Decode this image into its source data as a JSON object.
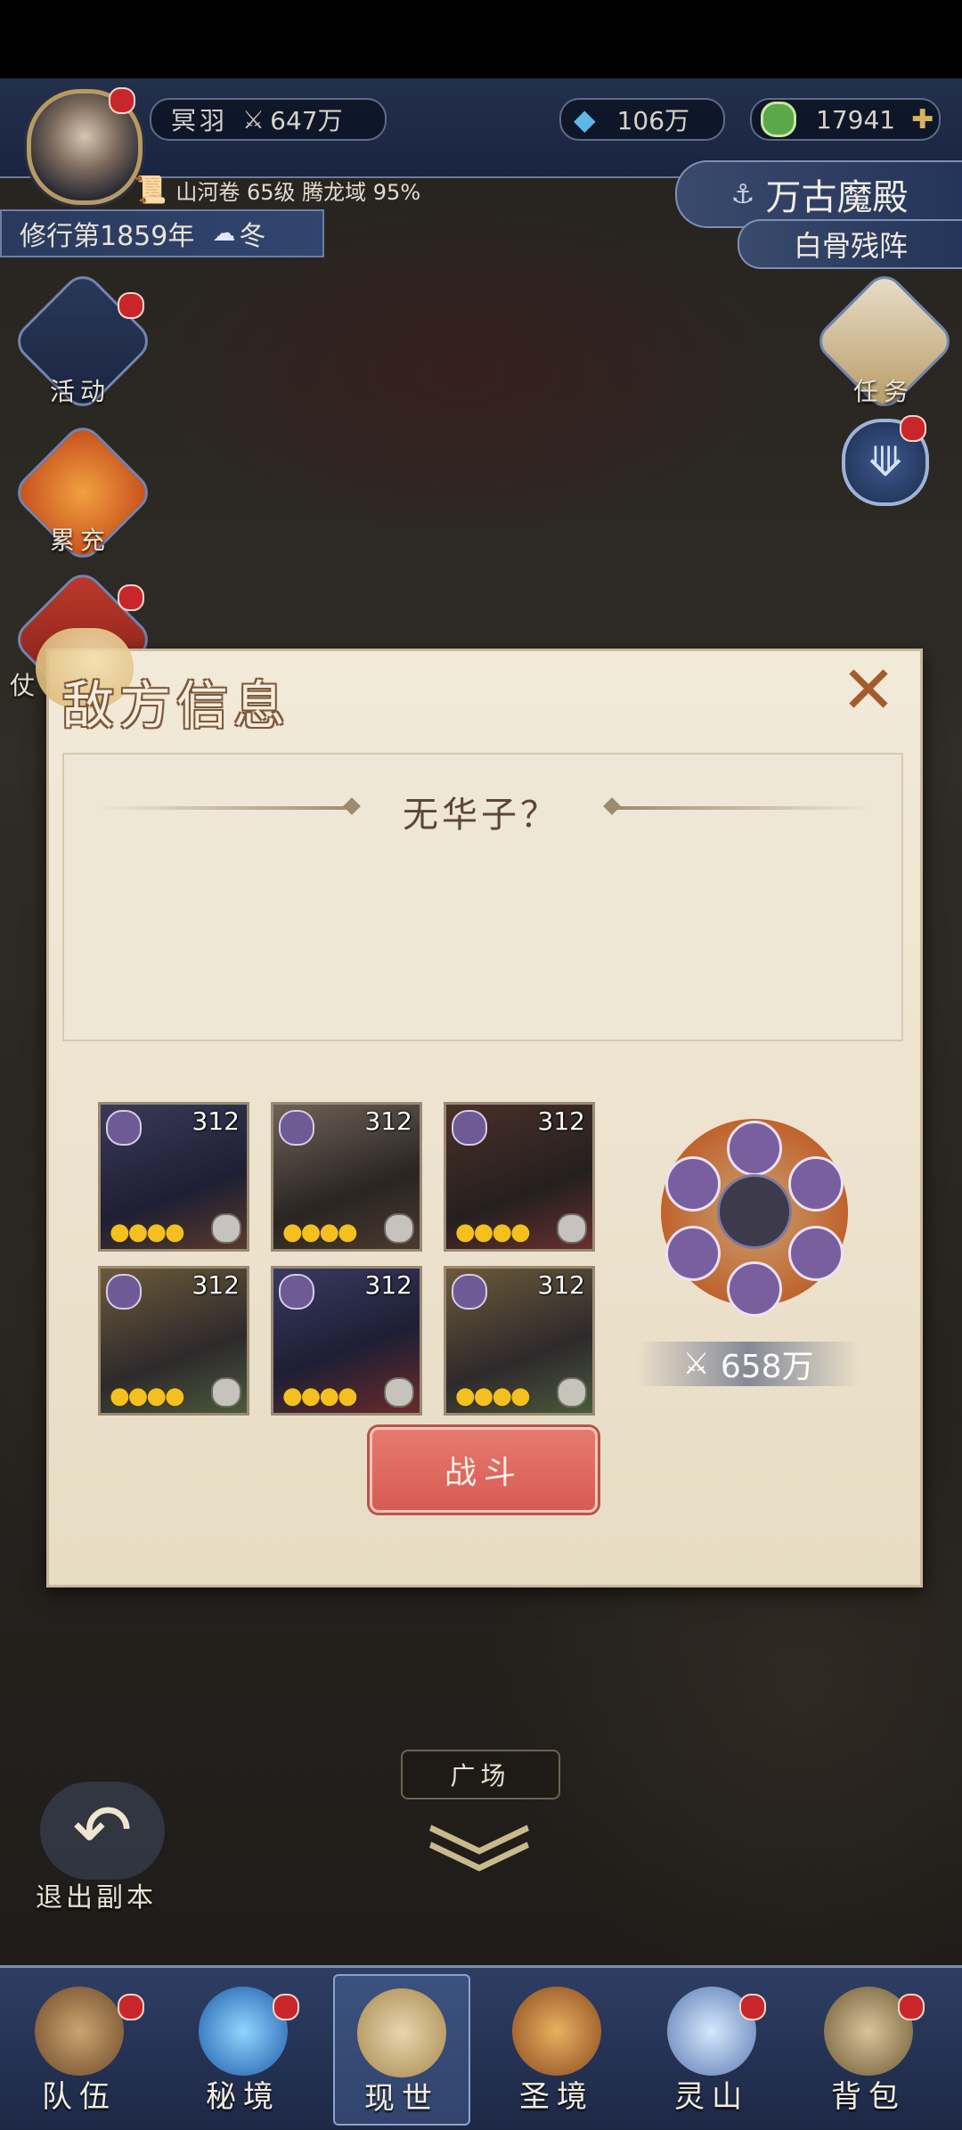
{
  "topbar": {
    "player_name": "冥羽",
    "player_power": "647万",
    "crystal": "106万",
    "jade": "17941",
    "level_info": "山河卷 65级 腾龙域 95%",
    "year": "修行第1859年",
    "season": "冬"
  },
  "location": {
    "title": "万古魔殿",
    "subtitle": "白骨残阵"
  },
  "side_left": [
    {
      "label": "活动"
    },
    {
      "label": "累充"
    },
    {
      "label": "仗"
    }
  ],
  "side_right": [
    {
      "label": "任务"
    }
  ],
  "dialog": {
    "title": "敌方信息",
    "enemy_name": "无华子？",
    "formation_power": "658万",
    "fight_label": "战斗",
    "cards": [
      {
        "level": "312",
        "stars": "●●●●"
      },
      {
        "level": "312",
        "stars": "●●●●"
      },
      {
        "level": "312",
        "stars": "●●●●"
      },
      {
        "level": "312",
        "stars": "●●●●"
      },
      {
        "level": "312",
        "stars": "●●●●"
      },
      {
        "level": "312",
        "stars": "●●●●"
      }
    ]
  },
  "square_label": "广场",
  "exit_label": "退出副本",
  "nav": [
    {
      "label": "队伍",
      "icon": "team-icon"
    },
    {
      "label": "秘境",
      "icon": "portal-icon"
    },
    {
      "label": "现世",
      "icon": "scroll-icon"
    },
    {
      "label": "圣境",
      "icon": "palace-icon"
    },
    {
      "label": "灵山",
      "icon": "mountain-icon"
    },
    {
      "label": "背包",
      "icon": "bag-icon"
    }
  ],
  "colors": {
    "accent_blue": "#2e3e63",
    "dialog_bg": "#f2ead9",
    "fight_button": "#d75b52",
    "notification": "#c8262b"
  }
}
